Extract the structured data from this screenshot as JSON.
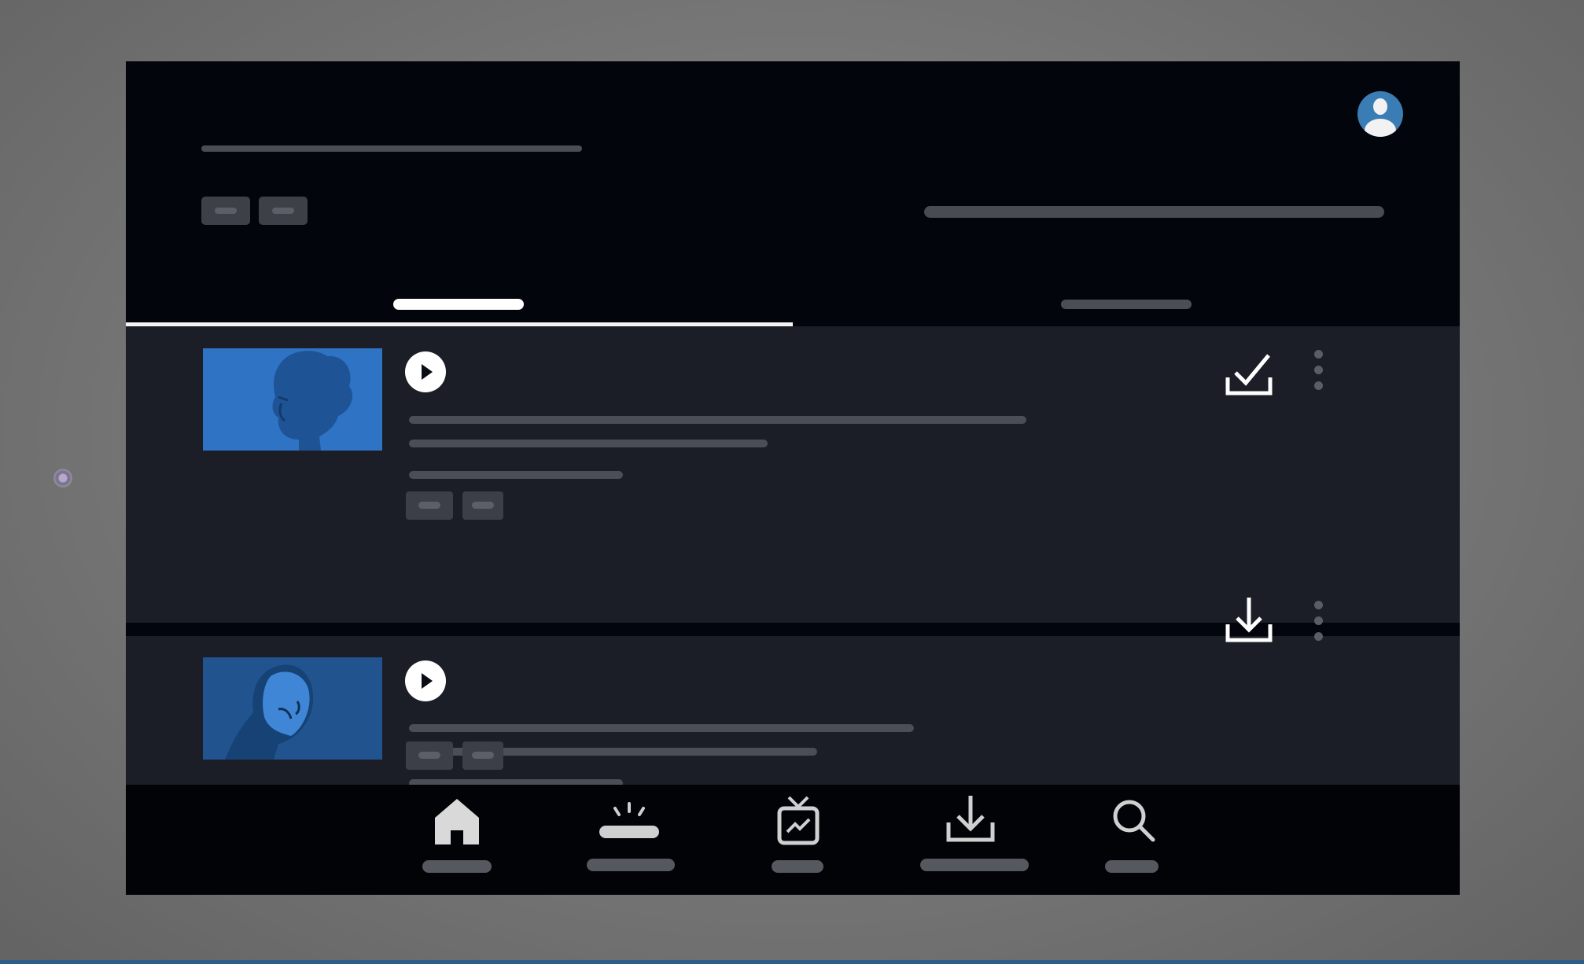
{
  "screen": {
    "theme": "dark",
    "background": "#03050c",
    "content_background": "#1b1e27",
    "accent": "#ffffff"
  },
  "header": {
    "title": "",
    "chips": [
      "",
      ""
    ],
    "search_text": "",
    "account_icon": "account-circle-icon"
  },
  "tabs": [
    {
      "label": "",
      "selected": true
    },
    {
      "label": "",
      "selected": false
    }
  ],
  "items": [
    {
      "thumbnail": "illustrated-portrait-thumbnail",
      "play_icon": "play-icon",
      "title": "",
      "subtitle": "",
      "meta": "",
      "tags": [
        "",
        ""
      ],
      "download_state": "downloaded",
      "download_icon": "download-done-icon",
      "menu_icon": "more-vertical-icon"
    },
    {
      "thumbnail": "illustrated-portrait-thumbnail",
      "play_icon": "play-icon",
      "title": "",
      "subtitle": "",
      "meta": "",
      "tags": [
        "",
        ""
      ],
      "download_state": "not-downloaded",
      "download_icon": "download-icon",
      "menu_icon": "more-vertical-icon"
    }
  ],
  "nav": [
    {
      "icon": "home-icon",
      "label": "",
      "selected": true
    },
    {
      "icon": "trending-icon",
      "label": "",
      "selected": false
    },
    {
      "icon": "live-tv-icon",
      "label": "",
      "selected": false
    },
    {
      "icon": "download-icon",
      "label": "",
      "selected": false
    },
    {
      "icon": "search-icon",
      "label": "",
      "selected": false
    }
  ]
}
